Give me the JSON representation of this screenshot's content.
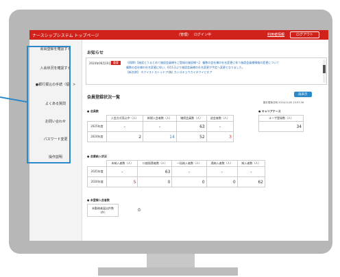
{
  "header": {
    "title": "ナースシップシステム トップページ",
    "status": "(管理)",
    "login": "ログイン中",
    "my_info": "利用者情報",
    "logout": "ログアウト"
  },
  "sidebar": {
    "items": [
      {
        "label": "会員登録を確認する"
      },
      {
        "label": "入会状況を確認する"
      },
      {
        "label": "●銀行振込の手続（個）>"
      },
      {
        "label": "よくある質問"
      },
      {
        "label": "お問い合わせ"
      },
      {
        "label": "パスワード変更"
      },
      {
        "label": "操作説明"
      }
    ]
  },
  "notice": {
    "title": "お知らせ",
    "date": "2024年06月10日",
    "tag": "重要",
    "lines": [
      "《再掲》【施設とうまとめて施設会員様をご登録の施設様へ】 複数の会社様の社名変更に伴う施設会員様情報の変更について",
      "複数の会社様の社名変更に伴い、6月1日より施設会員様の社名変更が予定へ変更となりました。",
      "【新名称】 ネクイストストゥドア(株) カンゴキョウカイネクイとすア"
    ]
  },
  "registration": {
    "title": "会員登録状況一覧",
    "refresh_label": "再表示",
    "timestamp": "集計更新日時 2024/11/05 15:57:36"
  },
  "members_table": {
    "label": "● 会員数",
    "headers": [
      "",
      "入会方式見込中（人）",
      "新規入会者数（人）",
      "継続会員数（人）",
      "退会者数（人）"
    ],
    "rows": [
      {
        "year": "2025年度",
        "values": [
          "-",
          "-",
          "63",
          "-"
        ]
      },
      {
        "year": "2024年度",
        "values": [
          "2",
          "14",
          "52",
          "3"
        ]
      }
    ]
  },
  "career_table": {
    "label": "● キャリアナース",
    "header": "ユーザ登録数（人）",
    "value": "34"
  },
  "payment_table": {
    "label": "● 会費納入状況",
    "headers": [
      "",
      "未納入者数（人）",
      "口座振替者数（人）",
      "一括納入者数（人）",
      "過納入者数（人）",
      "納入者数（人）"
    ],
    "rows": [
      {
        "year": "2025年度",
        "values": [
          "-",
          "63",
          "-",
          "-",
          "-"
        ]
      },
      {
        "year": "2024年度",
        "values": [
          "5",
          "0",
          "0",
          "0",
          "62"
        ]
      }
    ]
  },
  "unregistered_table": {
    "label": "● 未登録入会者数",
    "header": "未勤務者届出件数（件）",
    "value": "0"
  }
}
